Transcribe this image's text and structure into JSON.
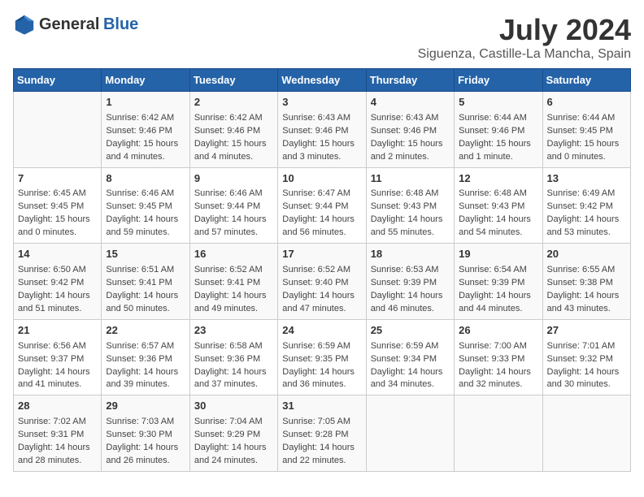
{
  "logo": {
    "general": "General",
    "blue": "Blue"
  },
  "title": "July 2024",
  "subtitle": "Siguenza, Castille-La Mancha, Spain",
  "days_header": [
    "Sunday",
    "Monday",
    "Tuesday",
    "Wednesday",
    "Thursday",
    "Friday",
    "Saturday"
  ],
  "weeks": [
    [
      {
        "day": "",
        "content": ""
      },
      {
        "day": "1",
        "content": "Sunrise: 6:42 AM\nSunset: 9:46 PM\nDaylight: 15 hours\nand 4 minutes."
      },
      {
        "day": "2",
        "content": "Sunrise: 6:42 AM\nSunset: 9:46 PM\nDaylight: 15 hours\nand 4 minutes."
      },
      {
        "day": "3",
        "content": "Sunrise: 6:43 AM\nSunset: 9:46 PM\nDaylight: 15 hours\nand 3 minutes."
      },
      {
        "day": "4",
        "content": "Sunrise: 6:43 AM\nSunset: 9:46 PM\nDaylight: 15 hours\nand 2 minutes."
      },
      {
        "day": "5",
        "content": "Sunrise: 6:44 AM\nSunset: 9:46 PM\nDaylight: 15 hours\nand 1 minute."
      },
      {
        "day": "6",
        "content": "Sunrise: 6:44 AM\nSunset: 9:45 PM\nDaylight: 15 hours\nand 0 minutes."
      }
    ],
    [
      {
        "day": "7",
        "content": "Sunrise: 6:45 AM\nSunset: 9:45 PM\nDaylight: 15 hours\nand 0 minutes."
      },
      {
        "day": "8",
        "content": "Sunrise: 6:46 AM\nSunset: 9:45 PM\nDaylight: 14 hours\nand 59 minutes."
      },
      {
        "day": "9",
        "content": "Sunrise: 6:46 AM\nSunset: 9:44 PM\nDaylight: 14 hours\nand 57 minutes."
      },
      {
        "day": "10",
        "content": "Sunrise: 6:47 AM\nSunset: 9:44 PM\nDaylight: 14 hours\nand 56 minutes."
      },
      {
        "day": "11",
        "content": "Sunrise: 6:48 AM\nSunset: 9:43 PM\nDaylight: 14 hours\nand 55 minutes."
      },
      {
        "day": "12",
        "content": "Sunrise: 6:48 AM\nSunset: 9:43 PM\nDaylight: 14 hours\nand 54 minutes."
      },
      {
        "day": "13",
        "content": "Sunrise: 6:49 AM\nSunset: 9:42 PM\nDaylight: 14 hours\nand 53 minutes."
      }
    ],
    [
      {
        "day": "14",
        "content": "Sunrise: 6:50 AM\nSunset: 9:42 PM\nDaylight: 14 hours\nand 51 minutes."
      },
      {
        "day": "15",
        "content": "Sunrise: 6:51 AM\nSunset: 9:41 PM\nDaylight: 14 hours\nand 50 minutes."
      },
      {
        "day": "16",
        "content": "Sunrise: 6:52 AM\nSunset: 9:41 PM\nDaylight: 14 hours\nand 49 minutes."
      },
      {
        "day": "17",
        "content": "Sunrise: 6:52 AM\nSunset: 9:40 PM\nDaylight: 14 hours\nand 47 minutes."
      },
      {
        "day": "18",
        "content": "Sunrise: 6:53 AM\nSunset: 9:39 PM\nDaylight: 14 hours\nand 46 minutes."
      },
      {
        "day": "19",
        "content": "Sunrise: 6:54 AM\nSunset: 9:39 PM\nDaylight: 14 hours\nand 44 minutes."
      },
      {
        "day": "20",
        "content": "Sunrise: 6:55 AM\nSunset: 9:38 PM\nDaylight: 14 hours\nand 43 minutes."
      }
    ],
    [
      {
        "day": "21",
        "content": "Sunrise: 6:56 AM\nSunset: 9:37 PM\nDaylight: 14 hours\nand 41 minutes."
      },
      {
        "day": "22",
        "content": "Sunrise: 6:57 AM\nSunset: 9:36 PM\nDaylight: 14 hours\nand 39 minutes."
      },
      {
        "day": "23",
        "content": "Sunrise: 6:58 AM\nSunset: 9:36 PM\nDaylight: 14 hours\nand 37 minutes."
      },
      {
        "day": "24",
        "content": "Sunrise: 6:59 AM\nSunset: 9:35 PM\nDaylight: 14 hours\nand 36 minutes."
      },
      {
        "day": "25",
        "content": "Sunrise: 6:59 AM\nSunset: 9:34 PM\nDaylight: 14 hours\nand 34 minutes."
      },
      {
        "day": "26",
        "content": "Sunrise: 7:00 AM\nSunset: 9:33 PM\nDaylight: 14 hours\nand 32 minutes."
      },
      {
        "day": "27",
        "content": "Sunrise: 7:01 AM\nSunset: 9:32 PM\nDaylight: 14 hours\nand 30 minutes."
      }
    ],
    [
      {
        "day": "28",
        "content": "Sunrise: 7:02 AM\nSunset: 9:31 PM\nDaylight: 14 hours\nand 28 minutes."
      },
      {
        "day": "29",
        "content": "Sunrise: 7:03 AM\nSunset: 9:30 PM\nDaylight: 14 hours\nand 26 minutes."
      },
      {
        "day": "30",
        "content": "Sunrise: 7:04 AM\nSunset: 9:29 PM\nDaylight: 14 hours\nand 24 minutes."
      },
      {
        "day": "31",
        "content": "Sunrise: 7:05 AM\nSunset: 9:28 PM\nDaylight: 14 hours\nand 22 minutes."
      },
      {
        "day": "",
        "content": ""
      },
      {
        "day": "",
        "content": ""
      },
      {
        "day": "",
        "content": ""
      }
    ]
  ]
}
